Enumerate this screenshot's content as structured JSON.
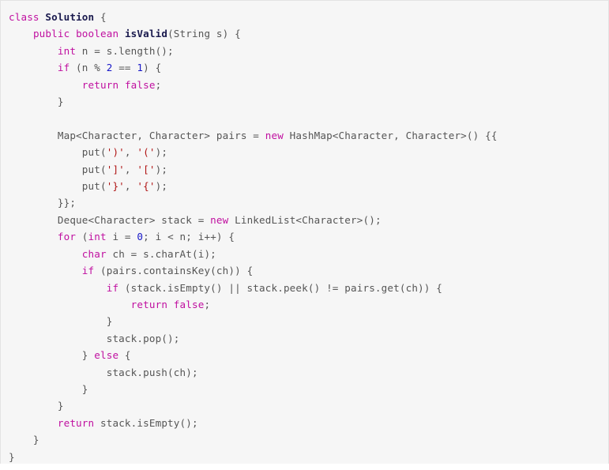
{
  "editor": {
    "language": "java",
    "background_color": "#f6f6f6",
    "border_color": "#e3e3e3",
    "default_text_color": "#555555",
    "colors": {
      "keyword": "#c010a0",
      "type_identifier": "#1a1a4e",
      "number": "#1818c8",
      "char_literal": "#b01414",
      "plain": "#555555"
    }
  },
  "code": {
    "title": "class Solution",
    "full_text": "class Solution {\n    public boolean isValid(String s) {\n        int n = s.length();\n        if (n % 2 == 1) {\n            return false;\n        }\n\n        Map<Character, Character> pairs = new HashMap<Character, Character>() {{\n            put(')', '(');\n            put(']', '[');\n            put('}', '{');\n        }};\n        Deque<Character> stack = new LinkedList<Character>();\n        for (int i = 0; i < n; i++) {\n            char ch = s.charAt(i);\n            if (pairs.containsKey(ch)) {\n                if (stack.isEmpty() || stack.peek() != pairs.get(ch)) {\n                    return false;\n                }\n                stack.pop();\n            } else {\n                stack.push(ch);\n            }\n        }\n        return stack.isEmpty();\n    }\n}",
    "lines": [
      {
        "n": 1,
        "indent": 0,
        "text": "class Solution {"
      },
      {
        "n": 2,
        "indent": 1,
        "text": "public boolean isValid(String s) {"
      },
      {
        "n": 3,
        "indent": 2,
        "text": "int n = s.length();"
      },
      {
        "n": 4,
        "indent": 2,
        "text": "if (n % 2 == 1) {"
      },
      {
        "n": 5,
        "indent": 3,
        "text": "return false;"
      },
      {
        "n": 6,
        "indent": 2,
        "text": "}"
      },
      {
        "n": 7,
        "indent": 0,
        "text": ""
      },
      {
        "n": 8,
        "indent": 2,
        "text": "Map<Character, Character> pairs = new HashMap<Character, Character>() {{"
      },
      {
        "n": 9,
        "indent": 3,
        "text": "put(')', '(');"
      },
      {
        "n": 10,
        "indent": 3,
        "text": "put(']', '[');"
      },
      {
        "n": 11,
        "indent": 3,
        "text": "put('}', '{');"
      },
      {
        "n": 12,
        "indent": 2,
        "text": "}};"
      },
      {
        "n": 13,
        "indent": 2,
        "text": "Deque<Character> stack = new LinkedList<Character>();"
      },
      {
        "n": 14,
        "indent": 2,
        "text": "for (int i = 0; i < n; i++) {"
      },
      {
        "n": 15,
        "indent": 3,
        "text": "char ch = s.charAt(i);"
      },
      {
        "n": 16,
        "indent": 3,
        "text": "if (pairs.containsKey(ch)) {"
      },
      {
        "n": 17,
        "indent": 4,
        "text": "if (stack.isEmpty() || stack.peek() != pairs.get(ch)) {"
      },
      {
        "n": 18,
        "indent": 5,
        "text": "return false;"
      },
      {
        "n": 19,
        "indent": 4,
        "text": "}"
      },
      {
        "n": 20,
        "indent": 4,
        "text": "stack.pop();"
      },
      {
        "n": 21,
        "indent": 3,
        "text": "} else {"
      },
      {
        "n": 22,
        "indent": 4,
        "text": "stack.push(ch);"
      },
      {
        "n": 23,
        "indent": 3,
        "text": "}"
      },
      {
        "n": 24,
        "indent": 2,
        "text": "}"
      },
      {
        "n": 25,
        "indent": 2,
        "text": "return stack.isEmpty();"
      },
      {
        "n": 26,
        "indent": 1,
        "text": "}"
      },
      {
        "n": 27,
        "indent": 0,
        "text": "}"
      }
    ],
    "tokens": {
      "keywords": [
        "class",
        "public",
        "boolean",
        "int",
        "if",
        "return",
        "false",
        "new",
        "for",
        "char",
        "else"
      ],
      "type_identifiers": [
        "Solution",
        "isValid"
      ],
      "numbers": [
        "2",
        "1",
        "0"
      ],
      "char_literals": [
        "')'",
        "'('",
        "']'",
        "'['",
        "'}'",
        "'{'"
      ]
    }
  }
}
